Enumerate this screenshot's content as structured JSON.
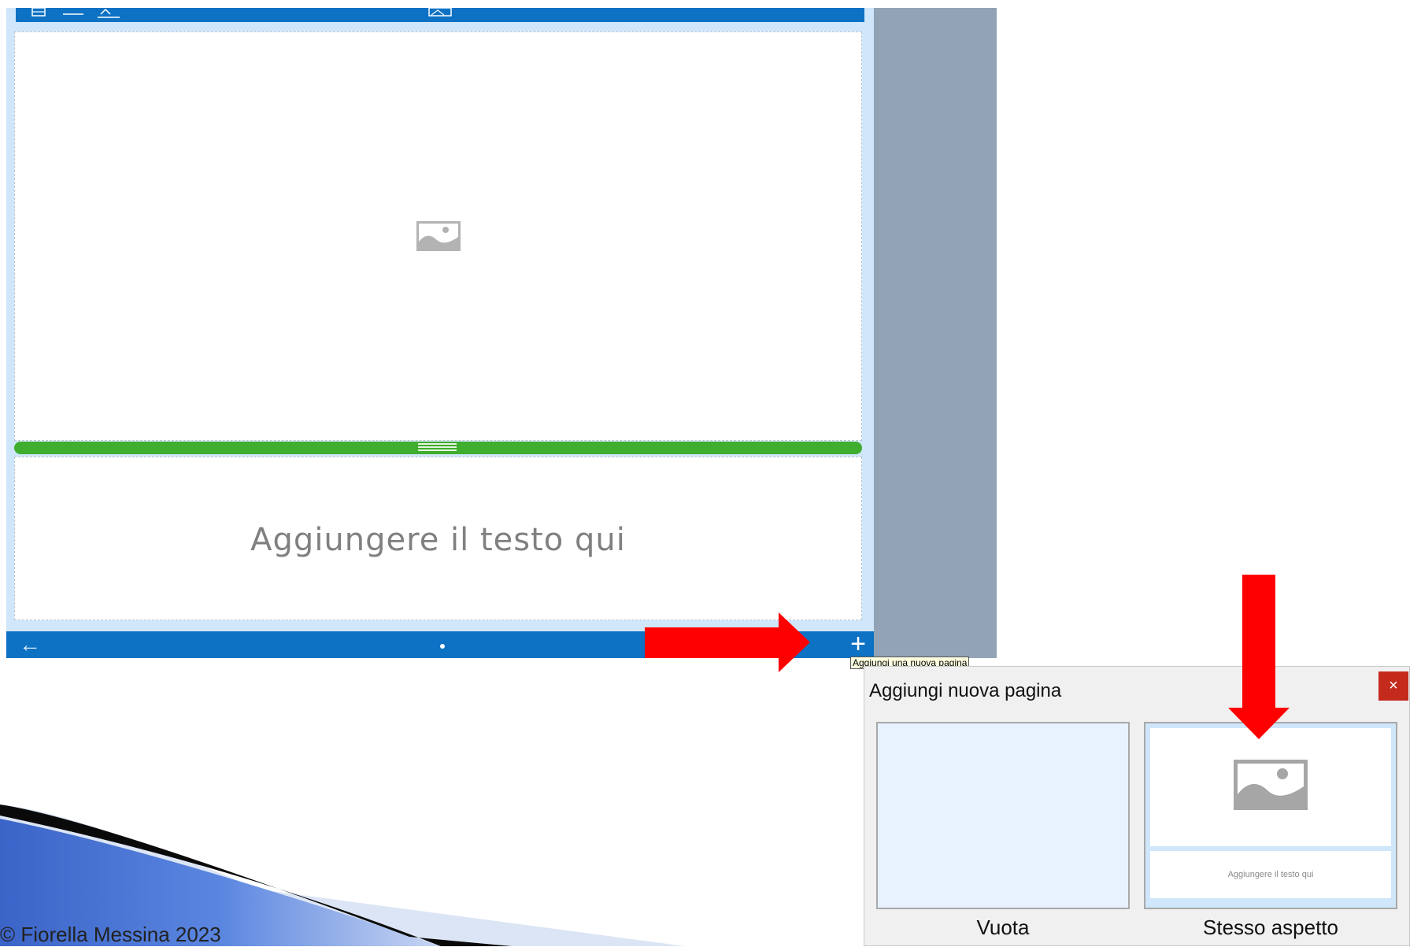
{
  "editor": {
    "image_panel_icon": "image-placeholder-icon",
    "text_placeholder": "Aggiungere il testo qui",
    "toolbar_icons": [
      "layout-icon",
      "divider-icon",
      "pen-icon",
      "image-icon"
    ],
    "bottom_bar": {
      "back_icon": "arrow-left-icon",
      "add_icon": "plus-icon",
      "tooltip": "Aggiungi una nuova pagina"
    }
  },
  "dialog": {
    "title": "Aggiungi nuova pagina",
    "close_label": "×",
    "options": [
      {
        "label": "Vuota"
      },
      {
        "label": "Stesso aspetto",
        "preview_text": "Aggiungere il testo qui"
      }
    ]
  },
  "footer": {
    "copyright": "© Fiorella Messina 2023"
  },
  "colors": {
    "accent_blue": "#0e72c4",
    "divider_green": "#3fae2e",
    "arrow_red": "#ff0000",
    "close_red": "#c42b1c"
  }
}
